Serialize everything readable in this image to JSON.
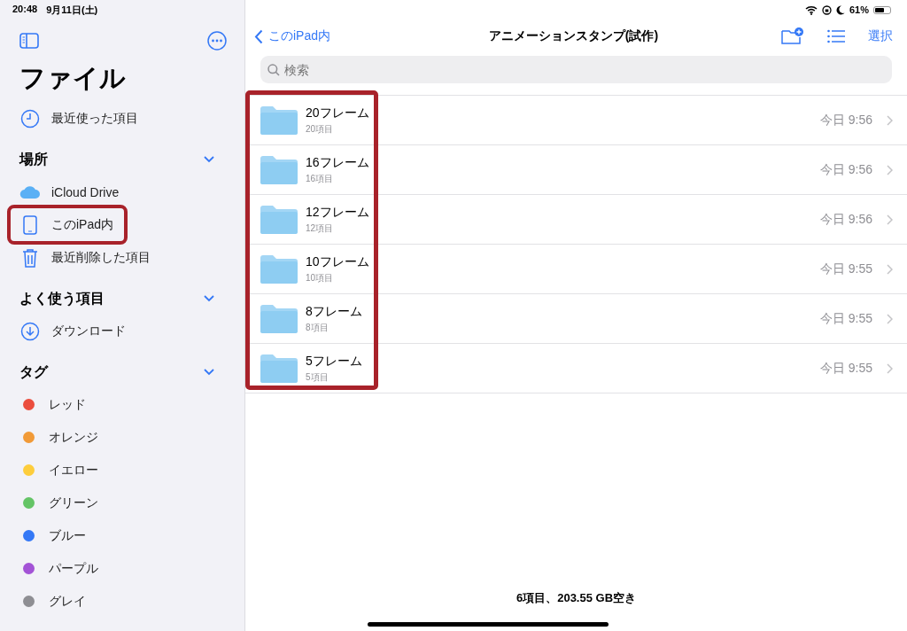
{
  "status_bar": {
    "time": "20:48",
    "date": "9月11日(土)",
    "battery_text": "61%"
  },
  "sidebar": {
    "title": "ファイル",
    "recent": {
      "label": "最近使った項目"
    },
    "sections": [
      {
        "title": "場所",
        "expanded": true,
        "items": [
          {
            "label": "iCloud Drive",
            "kind": "cloud",
            "annotated": false
          },
          {
            "label": "このiPad内",
            "kind": "tablet",
            "annotated": true
          },
          {
            "label": "最近削除した項目",
            "kind": "trash",
            "annotated": false
          }
        ]
      },
      {
        "title": "よく使う項目",
        "expanded": true,
        "items": [
          {
            "label": "ダウンロード",
            "kind": "download",
            "annotated": false
          }
        ]
      },
      {
        "title": "タグ",
        "expanded": true,
        "items": [
          {
            "label": "レッド",
            "kind": "tag",
            "color": "#eb4d3d",
            "annotated": false
          },
          {
            "label": "オレンジ",
            "kind": "tag",
            "color": "#f19a37",
            "annotated": false
          },
          {
            "label": "イエロー",
            "kind": "tag",
            "color": "#fdcd3c",
            "annotated": false
          },
          {
            "label": "グリーン",
            "kind": "tag",
            "color": "#64c466",
            "annotated": false
          },
          {
            "label": "ブルー",
            "kind": "tag",
            "color": "#3478f6",
            "annotated": false
          },
          {
            "label": "パープル",
            "kind": "tag",
            "color": "#a353d6",
            "annotated": false
          },
          {
            "label": "グレイ",
            "kind": "tag",
            "color": "#8e8e93",
            "annotated": false
          }
        ]
      }
    ]
  },
  "navigation": {
    "back": "このiPad内",
    "title": "アニメーションスタンプ(試作)",
    "select": "選択"
  },
  "search": {
    "placeholder": "検索"
  },
  "list": {
    "annotated": true,
    "rows": [
      {
        "name": "20フレーム",
        "count": "20項目",
        "date": "今日 9:56"
      },
      {
        "name": "16フレーム",
        "count": "16項目",
        "date": "今日 9:56"
      },
      {
        "name": "12フレーム",
        "count": "12項目",
        "date": "今日 9:56"
      },
      {
        "name": "10フレーム",
        "count": "10項目",
        "date": "今日 9:55"
      },
      {
        "name": "8フレーム",
        "count": "8項目",
        "date": "今日 9:55"
      },
      {
        "name": "5フレーム",
        "count": "5項目",
        "date": "今日 9:55"
      }
    ]
  },
  "footer": "6項目、203.55 GB空き"
}
